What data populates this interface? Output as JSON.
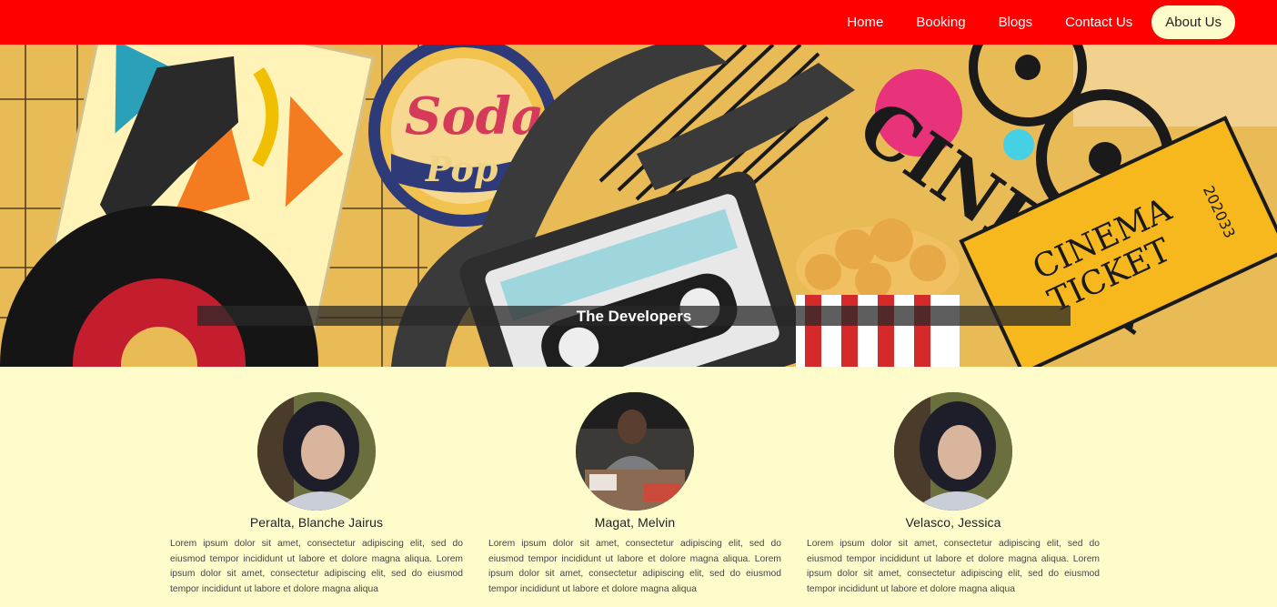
{
  "nav": {
    "items": [
      {
        "label": "Home"
      },
      {
        "label": "Booking"
      },
      {
        "label": "Blogs"
      },
      {
        "label": "Contact Us"
      },
      {
        "label": "About Us",
        "active": true
      }
    ]
  },
  "hero": {
    "title": "The Developers",
    "art_text": {
      "soda_line1": "Soda",
      "soda_line2": "Pop",
      "cinema": "CINEMA",
      "ticket_line1": "CINEMA",
      "ticket_line2": "TICKET",
      "ticket_number": "202033"
    }
  },
  "team": {
    "members": [
      {
        "name": "Peralta, Blanche Jairus",
        "bio": "Lorem ipsum dolor sit amet, consectetur adipiscing elit, sed do eiusmod tempor incididunt ut labore et dolore magna aliqua. Lorem ipsum dolor sit amet, consectetur adipiscing elit, sed do eiusmod tempor incididunt ut labore et dolore magna aliqua"
      },
      {
        "name": "Magat, Melvin",
        "bio": "Lorem ipsum dolor sit amet, consectetur adipiscing elit, sed do eiusmod tempor incididunt ut labore et dolore magna aliqua. Lorem ipsum dolor sit amet, consectetur adipiscing elit, sed do eiusmod tempor incididunt ut labore et dolore magna aliqua"
      },
      {
        "name": "Velasco, Jessica",
        "bio": "Lorem ipsum dolor sit amet, consectetur adipiscing elit, sed do eiusmod tempor incididunt ut labore et dolore magna aliqua. Lorem ipsum dolor sit amet, consectetur adipiscing elit, sed do eiusmod tempor incididunt ut labore et dolore magna aliqua"
      }
    ]
  },
  "colors": {
    "nav_bg": "#ff0000",
    "page_bg": "#fffccc",
    "hero_bg": "#e9bb57"
  }
}
